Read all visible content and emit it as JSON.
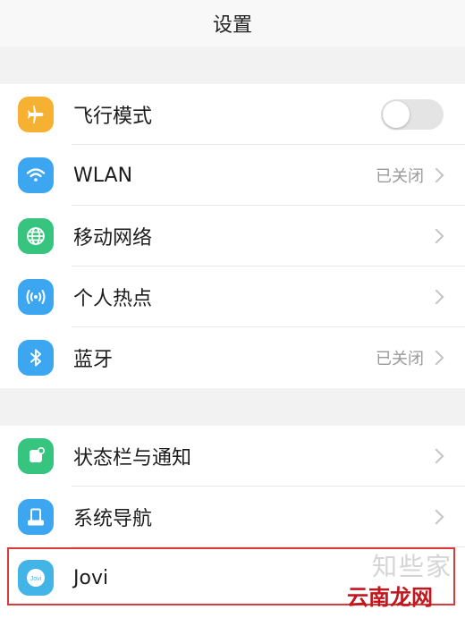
{
  "header": {
    "title": "设置"
  },
  "group1": [
    {
      "label": "飞行模式",
      "icon": "airplane-icon",
      "color": "#f6b133",
      "toggle": false
    },
    {
      "label": "WLAN",
      "icon": "wifi-icon",
      "color": "#3ca7f0",
      "status": "已关闭"
    },
    {
      "label": "移动网络",
      "icon": "globe-icon",
      "color": "#36c47e"
    },
    {
      "label": "个人热点",
      "icon": "hotspot-icon",
      "color": "#3ca7f0"
    },
    {
      "label": "蓝牙",
      "icon": "bluetooth-icon",
      "color": "#3ca7f0",
      "status": "已关闭"
    }
  ],
  "group2": [
    {
      "label": "状态栏与通知",
      "icon": "notification-icon",
      "color": "#36c47e"
    },
    {
      "label": "系统导航",
      "icon": "navigation-icon",
      "color": "#3ca7f0"
    },
    {
      "label": "Jovi",
      "icon": "jovi-icon",
      "color": "#43b4e6"
    }
  ],
  "watermark": {
    "text": "知些家",
    "red_text": "云南龙网"
  }
}
